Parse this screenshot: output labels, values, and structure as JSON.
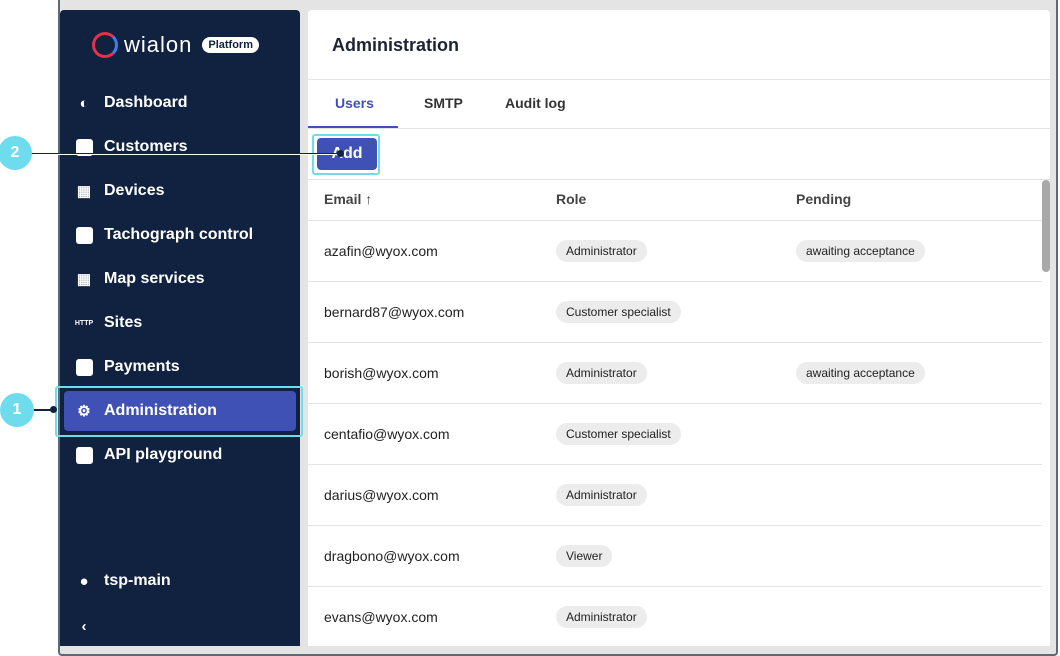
{
  "brand": {
    "name": "wialon",
    "badge": "Platform"
  },
  "sidebar": {
    "items": [
      {
        "label": "Dashboard",
        "icon": "pie-chart-icon"
      },
      {
        "label": "Customers",
        "icon": "briefcase-icon"
      },
      {
        "label": "Devices",
        "icon": "device-icon"
      },
      {
        "label": "Tachograph control",
        "icon": "tachograph-card-icon"
      },
      {
        "label": "Map services",
        "icon": "map-icon"
      },
      {
        "label": "Sites",
        "icon": "http-icon",
        "icon_text": "HTTP"
      },
      {
        "label": "Payments",
        "icon": "payment-icon"
      },
      {
        "label": "Administration",
        "icon": "gear-icon",
        "active": true
      },
      {
        "label": "API playground",
        "icon": "code-icon"
      }
    ],
    "user": "tsp-main",
    "collapse_icon": "chevron-left-icon"
  },
  "header": {
    "title": "Administration"
  },
  "tabs": [
    {
      "label": "Users",
      "active": true
    },
    {
      "label": "SMTP"
    },
    {
      "label": "Audit log"
    }
  ],
  "toolbar": {
    "add_label": "Add"
  },
  "table": {
    "columns": [
      "Email",
      "Role",
      "Pending"
    ],
    "sort": "Email ascending",
    "rows": [
      {
        "email": "azafin@wyox.com",
        "role": "Administrator",
        "pending": "awaiting acceptance"
      },
      {
        "email": "bernard87@wyox.com",
        "role": "Customer specialist",
        "pending": ""
      },
      {
        "email": "borish@wyox.com",
        "role": "Administrator",
        "pending": "awaiting acceptance"
      },
      {
        "email": "centafio@wyox.com",
        "role": "Customer specialist",
        "pending": ""
      },
      {
        "email": "darius@wyox.com",
        "role": "Administrator",
        "pending": ""
      },
      {
        "email": "dragbono@wyox.com",
        "role": "Viewer",
        "pending": ""
      },
      {
        "email": "evans@wyox.com",
        "role": "Administrator",
        "pending": ""
      }
    ]
  },
  "callouts": [
    "1",
    "2"
  ],
  "colors": {
    "sidebar": "#10223f",
    "accent": "#3f51b5",
    "callout": "#6fdcee"
  }
}
